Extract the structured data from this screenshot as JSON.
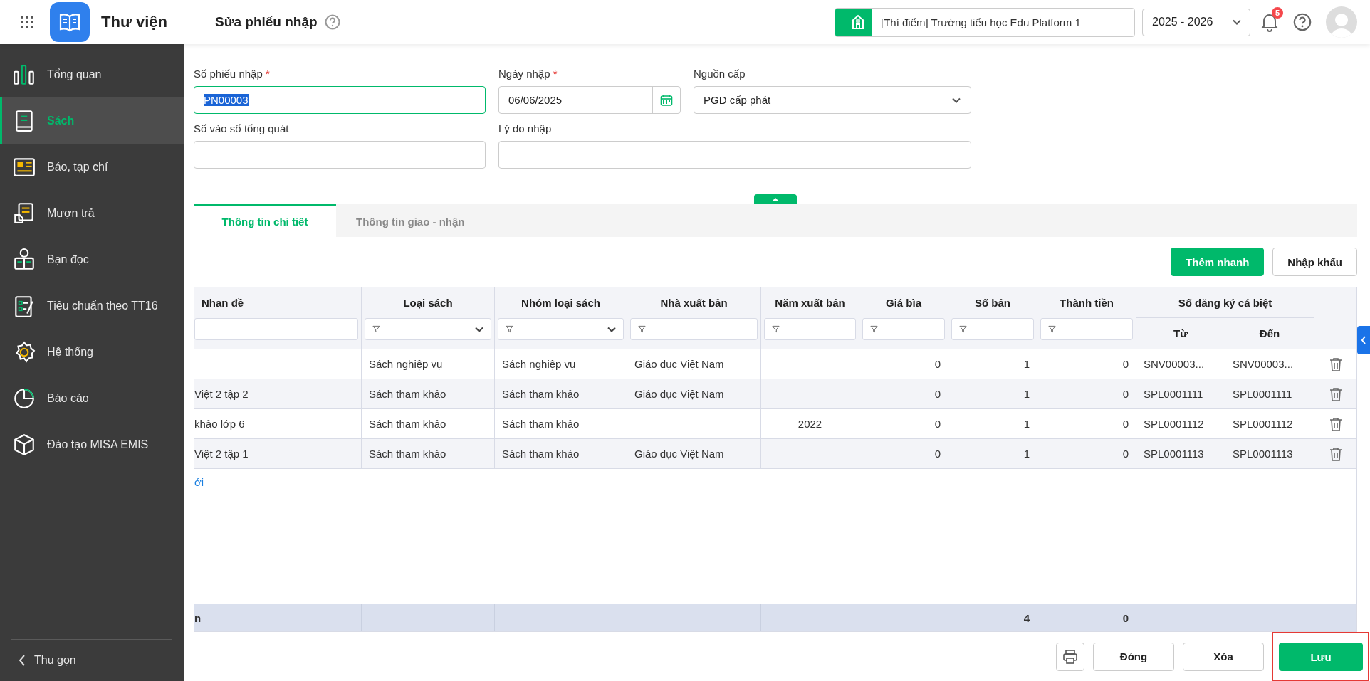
{
  "app": {
    "title": "Thư viện"
  },
  "page": {
    "title": "Sửa phiếu nhập"
  },
  "header": {
    "school": "[Thí điểm] Trường tiểu học Edu Platform 1",
    "year": "2025 - 2026",
    "notification_count": "5"
  },
  "sidebar": {
    "items": [
      {
        "label": "Tổng quan",
        "selected": false
      },
      {
        "label": "Sách",
        "selected": true
      },
      {
        "label": "Báo, tạp chí",
        "selected": false
      },
      {
        "label": "Mượn trả",
        "selected": false
      },
      {
        "label": "Bạn đọc",
        "selected": false
      },
      {
        "label": "Tiêu chuẩn theo TT16",
        "selected": false
      },
      {
        "label": "Hệ thống",
        "selected": false
      },
      {
        "label": "Báo cáo",
        "selected": false
      },
      {
        "label": "Đào tạo MISA EMIS",
        "selected": false
      }
    ],
    "collapse": "Thu gọn"
  },
  "form": {
    "fields": [
      {
        "label": "Số phiếu nhập",
        "required_mark": "*",
        "kind": "text",
        "value": "PN00003",
        "focused": true
      },
      {
        "label": "Ngày nhập",
        "required_mark": "*",
        "kind": "date",
        "value": "06/06/2025",
        "focused": false
      },
      {
        "label": "Nguồn cấp",
        "kind": "select",
        "value": "PGD cấp phát",
        "focused": false
      },
      {
        "label": "Số vào sổ tổng quát",
        "kind": "text",
        "focused": false
      },
      {
        "label": "Lý do nhập",
        "kind": "wide",
        "focused": false
      }
    ]
  },
  "tabs": [
    {
      "label": "Thông tin chi tiết",
      "selected": true
    },
    {
      "label": "Thông tin giao - nhận",
      "selected": false
    }
  ],
  "toolbar": {
    "buttons": [
      {
        "label": "Thêm nhanh",
        "kind": "primary"
      },
      {
        "label": "Nhập khẩu",
        "kind": "secondary"
      }
    ]
  },
  "table": {
    "columns": [
      {
        "label": "Nhan đề",
        "kind": "text"
      },
      {
        "label": "Loại sách",
        "kind": "select"
      },
      {
        "label": "Nhóm loại sách",
        "kind": "select"
      },
      {
        "label": "Nhà xuất bản",
        "kind": "filter"
      },
      {
        "label": "Năm xuất bản",
        "kind": "filter"
      },
      {
        "label": "Giá bìa",
        "kind": "filter"
      },
      {
        "label": "Số bản",
        "kind": "filter"
      },
      {
        "label": "Thành tiền",
        "kind": "filter"
      }
    ],
    "group": {
      "label": "Số đăng ký cá biệt",
      "columns": [
        {
          "label": "Từ"
        },
        {
          "label": "Đến"
        }
      ]
    },
    "rows": [
      {
        "cells": [
          null,
          "Sách nghiệp vụ",
          "Sách nghiệp vụ",
          "Giáo dục Việt Nam",
          null,
          "0",
          "1",
          "0",
          "SNV00003...",
          "SNV00003..."
        ]
      },
      {
        "cells": [
          "Việt 2 tập 2",
          "Sách tham khảo",
          "Sách tham khảo",
          "Giáo dục Việt Nam",
          null,
          "0",
          "1",
          "0",
          "SPL0001111",
          "SPL0001111"
        ]
      },
      {
        "cells": [
          "khảo lớp 6",
          "Sách tham khảo",
          "Sách tham khảo",
          null,
          "2022",
          "0",
          "1",
          "0",
          "SPL0001112",
          "SPL0001112"
        ]
      },
      {
        "cells": [
          "Việt 2 tập 1",
          "Sách tham khảo",
          "Sách tham khảo",
          "Giáo dục Việt Nam",
          null,
          "0",
          "1",
          "0",
          "SPL0001113",
          "SPL0001113"
        ]
      }
    ],
    "add_link": "ới",
    "footer": {
      "cells": [
        "n",
        null,
        null,
        null,
        null,
        null,
        "4",
        "0",
        null,
        null
      ]
    }
  },
  "actions": {
    "buttons": [
      {
        "kind": "print"
      },
      {
        "kind": "secondary",
        "label": "Đóng"
      },
      {
        "kind": "secondary",
        "label": "Xóa"
      },
      {
        "kind": "primary",
        "label": "Lưu",
        "highlighted": true
      }
    ]
  }
}
